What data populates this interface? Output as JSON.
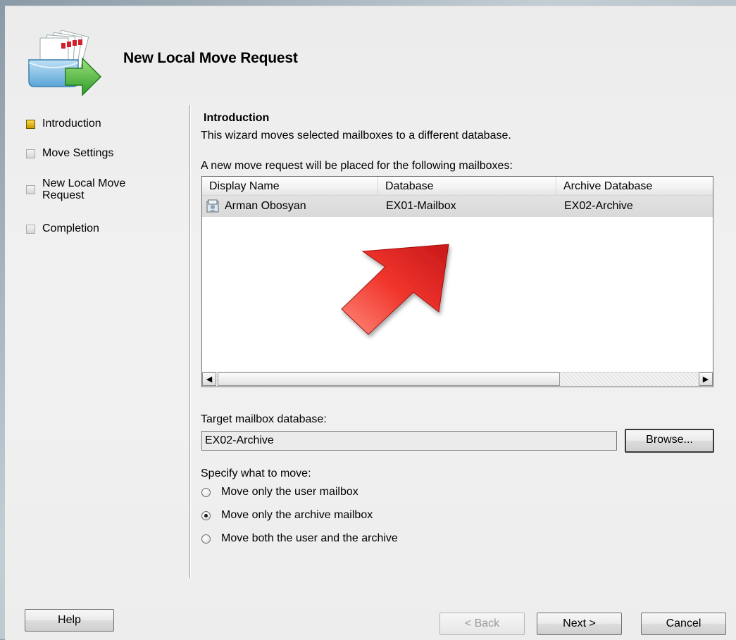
{
  "wizard": {
    "title": "New Local Move Request"
  },
  "steps": [
    {
      "label": "Introduction",
      "active": true
    },
    {
      "label": "Move Settings",
      "active": false
    },
    {
      "label": "New Local Move Request",
      "active": false
    },
    {
      "label": "Completion",
      "active": false
    }
  ],
  "intro": {
    "heading": "Introduction",
    "description": "This wizard moves selected mailboxes to a different database.",
    "list_caption": "A new move request will be placed for the following mailboxes:"
  },
  "mailbox_list": {
    "columns": [
      "Display Name",
      "Database",
      "Archive Database"
    ],
    "rows": [
      {
        "display_name": "Arman Obosyan",
        "database": "EX01-Mailbox",
        "archive_database": "EX02-Archive"
      }
    ]
  },
  "target": {
    "label": "Target mailbox database:",
    "value": "EX02-Archive",
    "browse_label": "Browse..."
  },
  "move_options": {
    "label": "Specify what to move:",
    "options": [
      {
        "label": "Move only the user mailbox",
        "checked": false
      },
      {
        "label": "Move only the archive mailbox",
        "checked": true
      },
      {
        "label": "Move both the user and the archive",
        "checked": false
      }
    ]
  },
  "footer": {
    "help_label": "Help",
    "back_label": "< Back",
    "next_label": "Next >",
    "cancel_label": "Cancel"
  },
  "icons": {
    "wizard": "move-mailbox-icon",
    "row": "mailbox-user-icon",
    "annotation": "red-arrow-annotation"
  },
  "colors": {
    "active_step": "#e0b000",
    "annotation_arrow": "#e8302a",
    "wizard_arrow": "#3cb043"
  }
}
